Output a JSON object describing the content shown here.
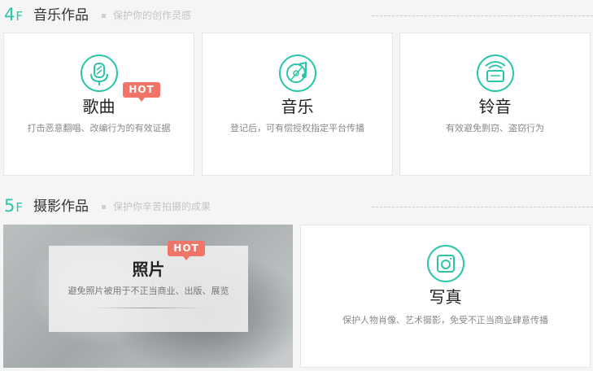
{
  "floor4": {
    "num": "4",
    "num_suffix": "F",
    "title": "音乐作品",
    "subtitle": "保护你的创作灵感",
    "cards": [
      {
        "icon": "microphone-icon",
        "title": "歌曲",
        "desc": "打击恶意翻唱、改编行为的有效证据",
        "badge": "HOT"
      },
      {
        "icon": "music-disc-icon",
        "title": "音乐",
        "desc": "登记后，可有偿授权指定平台传播"
      },
      {
        "icon": "ringtone-icon",
        "title": "铃音",
        "desc": "有效避免剽窃、盗窃行为"
      }
    ]
  },
  "floor5": {
    "num": "5",
    "num_suffix": "F",
    "title": "摄影作品",
    "subtitle": "保护你辛苦拍摄的成果",
    "photo": {
      "title": "照片",
      "desc": "避免照片被用于不正当商业、出版、展览",
      "badge": "HOT"
    },
    "portrait": {
      "icon": "camera-icon",
      "title": "写真",
      "desc": "保护人物肖像、艺术摄影，免受不正当商业肆意传播"
    }
  },
  "colors": {
    "accent": "#2cc5a9",
    "hot": "#f07467"
  }
}
